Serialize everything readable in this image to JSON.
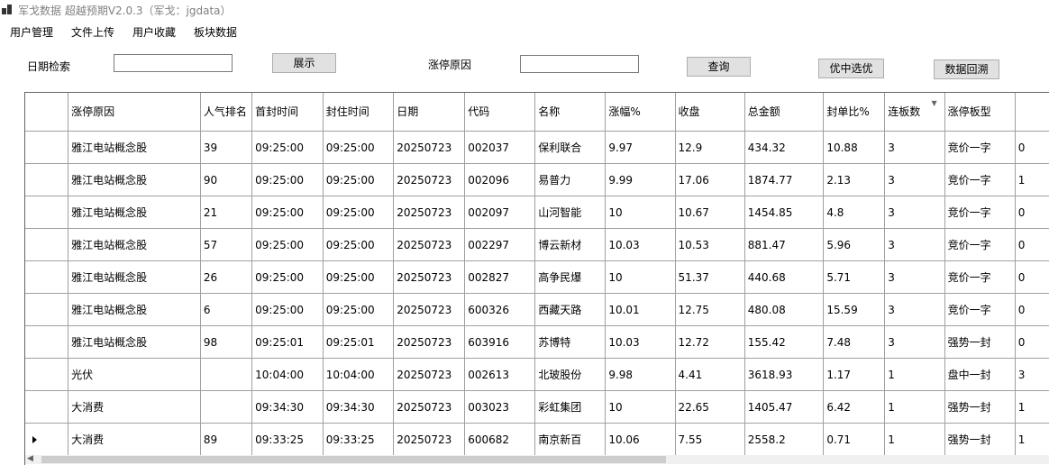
{
  "window": {
    "title": "军戈数据 超越预期V2.0.3（军戈：jgdata）"
  },
  "menu": {
    "items": [
      "用户管理",
      "文件上传",
      "用户收藏",
      "板块数据"
    ]
  },
  "toolbar": {
    "date_label": "日期检索",
    "date_value": "",
    "show_button": "展示",
    "reason_label": "涨停原因",
    "reason_value": "",
    "query_button": "查询",
    "select_button": "优中选优",
    "backtrack_button": "数据回溯"
  },
  "grid": {
    "headers": [
      "涨停原因",
      "人气排名",
      "首封时间",
      "封住时间",
      "日期",
      "代码",
      "名称",
      "涨幅%",
      "收盘",
      "总金额",
      "封单比%",
      "连板数",
      "涨停板型"
    ],
    "rows": [
      {
        "reason": "雅江电站概念股",
        "rank": "39",
        "first_seal": "09:25:00",
        "seal": "09:25:00",
        "date": "20250723",
        "code": "002037",
        "name": "保利联合",
        "pct": "9.97",
        "close": "12.9",
        "amount": "434.32",
        "seal_ratio": "10.88",
        "boards": "3",
        "type": "竞价一字",
        "extra": "0"
      },
      {
        "reason": "雅江电站概念股",
        "rank": "90",
        "first_seal": "09:25:00",
        "seal": "09:25:00",
        "date": "20250723",
        "code": "002096",
        "name": "易普力",
        "pct": "9.99",
        "close": "17.06",
        "amount": "1874.77",
        "seal_ratio": "2.13",
        "boards": "3",
        "type": "竞价一字",
        "extra": "1"
      },
      {
        "reason": "雅江电站概念股",
        "rank": "21",
        "first_seal": "09:25:00",
        "seal": "09:25:00",
        "date": "20250723",
        "code": "002097",
        "name": "山河智能",
        "pct": "10",
        "close": "10.67",
        "amount": "1454.85",
        "seal_ratio": "4.8",
        "boards": "3",
        "type": "竞价一字",
        "extra": "0"
      },
      {
        "reason": "雅江电站概念股",
        "rank": "57",
        "first_seal": "09:25:00",
        "seal": "09:25:00",
        "date": "20250723",
        "code": "002297",
        "name": "博云新材",
        "pct": "10.03",
        "close": "10.53",
        "amount": "881.47",
        "seal_ratio": "5.96",
        "boards": "3",
        "type": "竞价一字",
        "extra": "0"
      },
      {
        "reason": "雅江电站概念股",
        "rank": "26",
        "first_seal": "09:25:00",
        "seal": "09:25:00",
        "date": "20250723",
        "code": "002827",
        "name": "高争民爆",
        "pct": "10",
        "close": "51.37",
        "amount": "440.68",
        "seal_ratio": "5.71",
        "boards": "3",
        "type": "竞价一字",
        "extra": "0"
      },
      {
        "reason": "雅江电站概念股",
        "rank": "6",
        "first_seal": "09:25:00",
        "seal": "09:25:00",
        "date": "20250723",
        "code": "600326",
        "name": "西藏天路",
        "pct": "10.01",
        "close": "12.75",
        "amount": "480.08",
        "seal_ratio": "15.59",
        "boards": "3",
        "type": "竞价一字",
        "extra": "0"
      },
      {
        "reason": "雅江电站概念股",
        "rank": "98",
        "first_seal": "09:25:01",
        "seal": "09:25:01",
        "date": "20250723",
        "code": "603916",
        "name": "苏博特",
        "pct": "10.03",
        "close": "12.72",
        "amount": "155.42",
        "seal_ratio": "7.48",
        "boards": "3",
        "type": "强势一封",
        "extra": "0"
      },
      {
        "reason": "光伏",
        "rank": "",
        "first_seal": "10:04:00",
        "seal": "10:04:00",
        "date": "20250723",
        "code": "002613",
        "name": "北玻股份",
        "pct": "9.98",
        "close": "4.41",
        "amount": "3618.93",
        "seal_ratio": "1.17",
        "boards": "1",
        "type": "盘中一封",
        "extra": "3"
      },
      {
        "reason": "大消费",
        "rank": "",
        "first_seal": "09:34:30",
        "seal": "09:34:30",
        "date": "20250723",
        "code": "003023",
        "name": "彩虹集团",
        "pct": "10",
        "close": "22.65",
        "amount": "1405.47",
        "seal_ratio": "6.42",
        "boards": "1",
        "type": "强势一封",
        "extra": "1"
      },
      {
        "reason": "大消费",
        "rank": "89",
        "first_seal": "09:33:25",
        "seal": "09:33:25",
        "date": "20250723",
        "code": "600682",
        "name": "南京新百",
        "pct": "10.06",
        "close": "7.55",
        "amount": "2558.2",
        "seal_ratio": "0.71",
        "boards": "1",
        "type": "强势一封",
        "extra": "1"
      }
    ]
  },
  "scrollbar": {
    "position": 0.0,
    "visible_fraction": 0.62
  }
}
